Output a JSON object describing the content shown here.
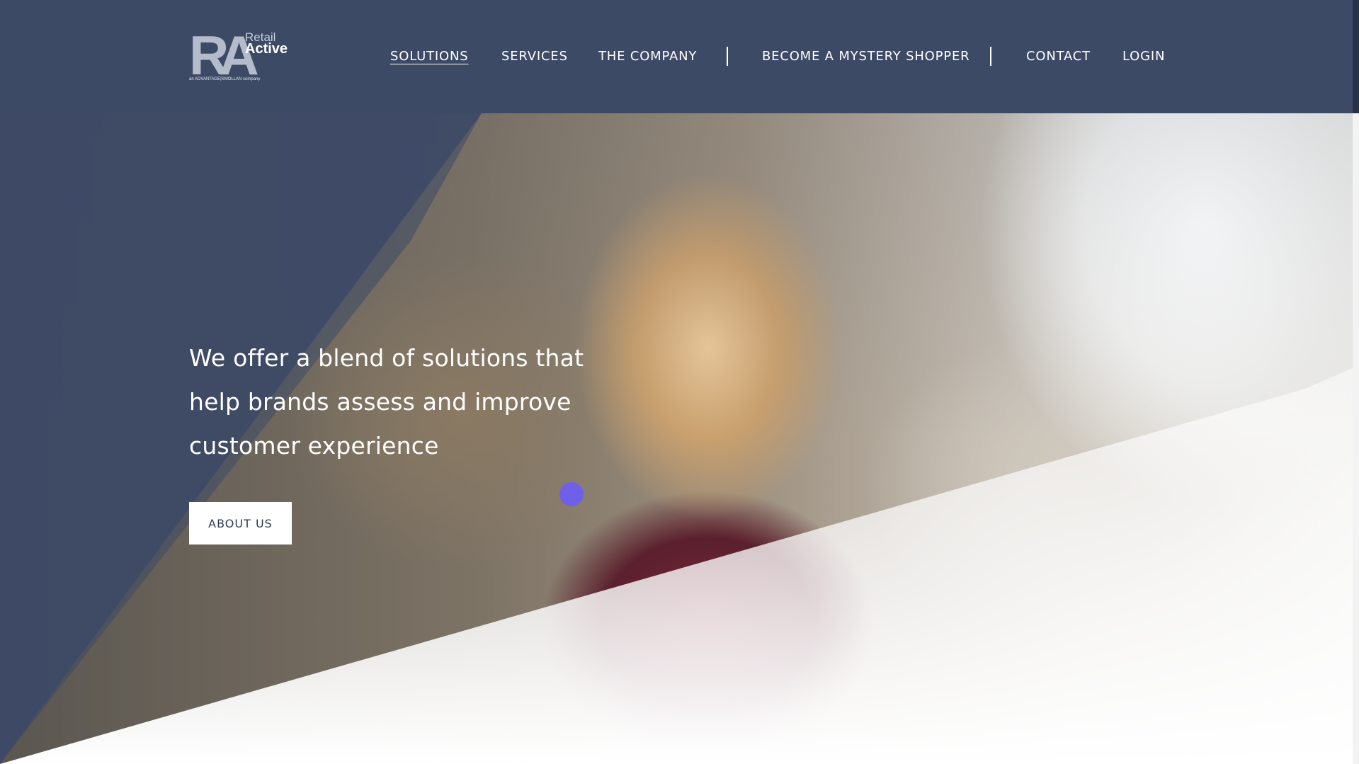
{
  "brand": {
    "mark": "RA",
    "line1": "Retail",
    "line2": "Active",
    "tagline": "an ADVANTAGE|SMOLLAN company"
  },
  "nav": {
    "items": [
      {
        "label": "SOLUTIONS",
        "active": true
      },
      {
        "label": "SERVICES",
        "active": false
      },
      {
        "label": "THE COMPANY",
        "active": false
      },
      {
        "label": "BECOME A MYSTERY SHOPPER",
        "active": false
      },
      {
        "label": "CONTACT",
        "active": false
      },
      {
        "label": "LOGIN",
        "active": false
      }
    ]
  },
  "hero": {
    "headline": "We offer a blend of solutions that help brands assess and improve customer experience",
    "cta_label": "ABOUT US"
  },
  "colors": {
    "header_bg": "#3d4a66",
    "overlay": "#3d4a66",
    "button_bg": "#ffffff",
    "button_text": "#2f3a52",
    "accent_dot": "#6b5bff"
  }
}
